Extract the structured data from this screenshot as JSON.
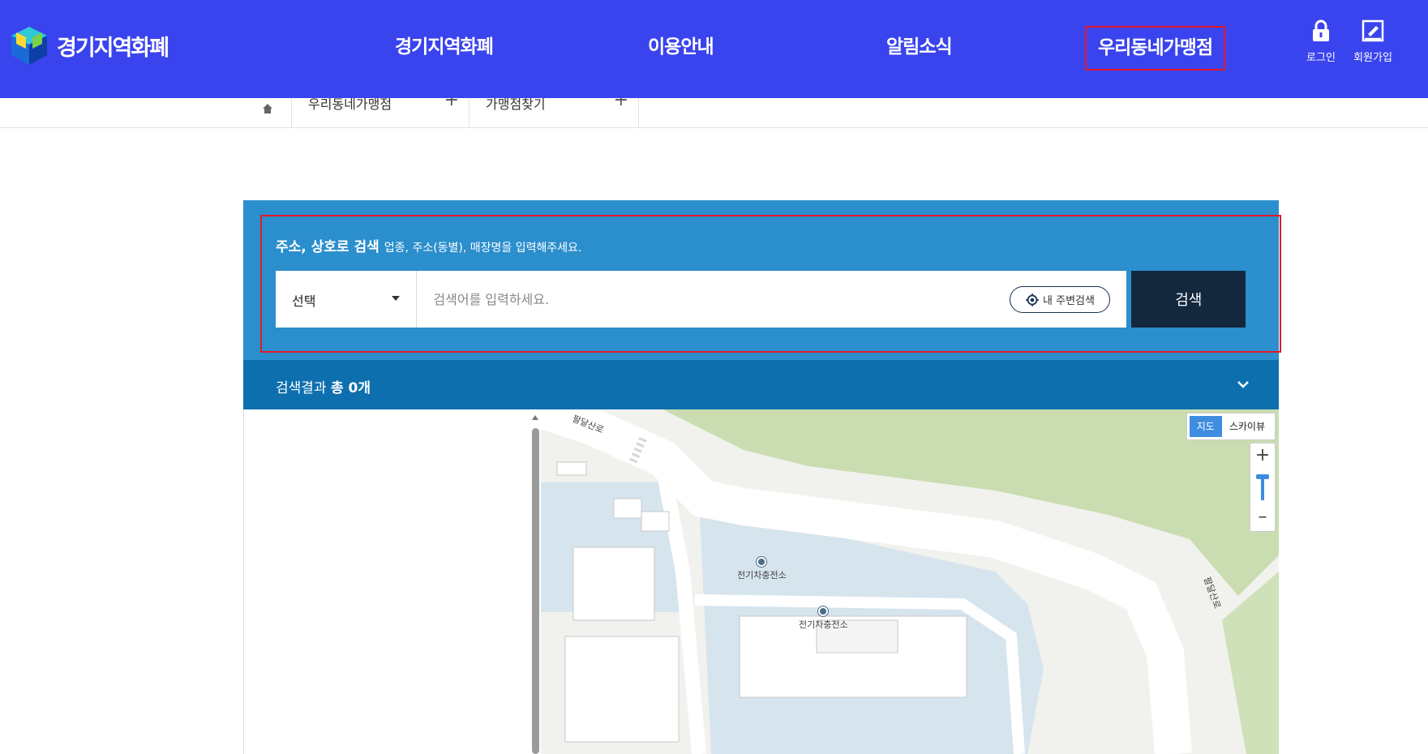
{
  "brand": {
    "name": "경기지역화폐"
  },
  "gnb": {
    "items": [
      {
        "label": "경기지역화폐"
      },
      {
        "label": "이용안내"
      },
      {
        "label": "알림소식"
      },
      {
        "label": "우리동네가맹점"
      }
    ]
  },
  "utility": {
    "login": "로그인",
    "signup": "회원가입"
  },
  "breadcrumb": {
    "items": [
      "우리동네가맹점",
      "가맹점찾기"
    ]
  },
  "search": {
    "title": "주소, 상호로 검색",
    "hint": "업종, 주소(동별), 매장명을 입력해주세요.",
    "select_value": "선택",
    "placeholder": "검색어를 입력하세요.",
    "nearby_label": "내 주변검색",
    "button_label": "검색"
  },
  "results": {
    "prefix": "검색결과 ",
    "count_text": "총 0개"
  },
  "map": {
    "type_buttons": [
      "지도",
      "스카이뷰"
    ],
    "selected_type": "지도",
    "road_label": "팔달산로",
    "poi_labels": [
      "전기차충전소",
      "전기차충전소"
    ]
  },
  "colors": {
    "header_bg": "#3a44ee",
    "panel_bg": "#2b8ecd",
    "result_bar_bg": "#0d6fae",
    "search_button_bg": "#13283d",
    "highlight": "#e3182a"
  }
}
